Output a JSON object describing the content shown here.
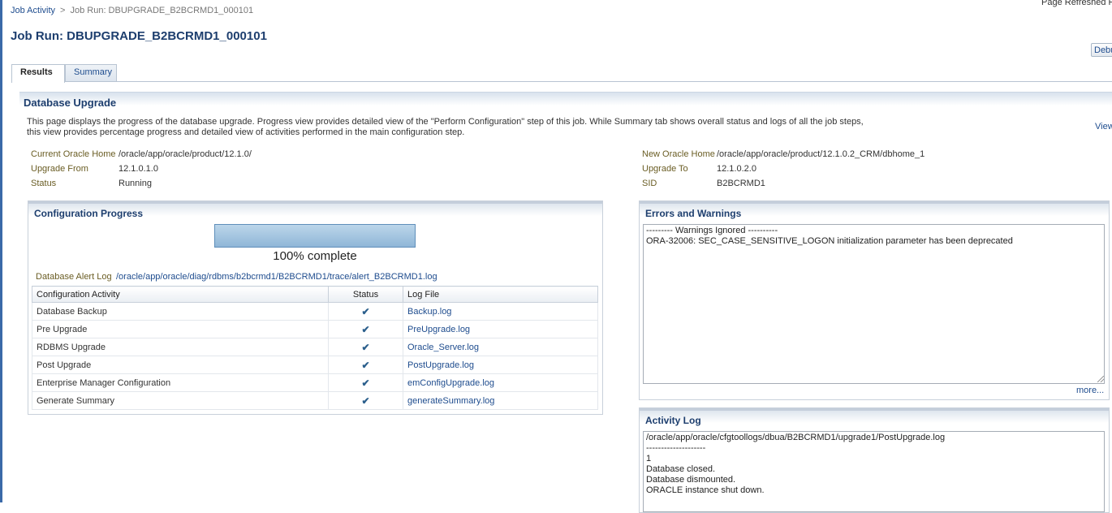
{
  "breadcrumb": {
    "parent": "Job Activity",
    "separator": ">",
    "current": "Job Run: DBUPGRADE_B2BCRMD1_000101"
  },
  "header": {
    "refreshed": "Page Refreshed F",
    "title": "Job Run: DBUPGRADE_B2BCRMD1_000101",
    "debug_label": "Debu"
  },
  "tabs": [
    {
      "label": "Results"
    },
    {
      "label": "Summary"
    }
  ],
  "section": {
    "title": "Database Upgrade",
    "description_line1": "This page displays the progress of the database upgrade. Progress view provides detailed view of the \"Perform Configuration\" step of this job. While Summary tab shows overall status and logs of all the job steps,",
    "description_line2": "this view provides percentage progress and detailed view of activities performed in the main configuration step.",
    "view_link": "View"
  },
  "info_left": [
    {
      "label": "Current Oracle Home",
      "value": "/oracle/app/oracle/product/12.1.0/"
    },
    {
      "label": "Upgrade From",
      "value": "12.1.0.1.0"
    },
    {
      "label": "Status",
      "value": "Running"
    }
  ],
  "info_right": [
    {
      "label": "New Oracle Home",
      "value": "/oracle/app/oracle/product/12.1.0.2_CRM/dbhome_1"
    },
    {
      "label": "Upgrade To",
      "value": "12.1.0.2.0"
    },
    {
      "label": "SID",
      "value": "B2BCRMD1"
    }
  ],
  "config_progress": {
    "title": "Configuration Progress",
    "progress_percent": 100,
    "progress_label": "100% complete",
    "alert_log_label": "Database Alert Log",
    "alert_log_path": "/oracle/app/oracle/diag/rdbms/b2bcrmd1/B2BCRMD1/trace/alert_B2BCRMD1.log",
    "columns": [
      "Configuration Activity",
      "Status",
      "Log File"
    ],
    "rows": [
      {
        "activity": "Database Backup",
        "status": "✔",
        "log": "Backup.log"
      },
      {
        "activity": "Pre Upgrade",
        "status": "✔",
        "log": "PreUpgrade.log"
      },
      {
        "activity": "RDBMS Upgrade",
        "status": "✔",
        "log": "Oracle_Server.log"
      },
      {
        "activity": "Post Upgrade",
        "status": "✔",
        "log": "PostUpgrade.log"
      },
      {
        "activity": "Enterprise Manager Configuration",
        "status": "✔",
        "log": "emConfigUpgrade.log"
      },
      {
        "activity": "Generate Summary",
        "status": "✔",
        "log": "generateSummary.log"
      }
    ]
  },
  "errors_warnings": {
    "title": "Errors and Warnings",
    "text": "--------- Warnings Ignored ----------\nORA-32006: SEC_CASE_SENSITIVE_LOGON initialization parameter has been deprecated",
    "more_link": "more..."
  },
  "activity_log": {
    "title": "Activity Log",
    "text": "/oracle/app/oracle/cfgtoollogs/dbua/B2BCRMD1/upgrade1/PostUpgrade.log\n--------------------\n1\nDatabase closed.\nDatabase dismounted.\nORACLE instance shut down."
  },
  "colors": {
    "accent": "#1d3e6e",
    "link": "#1e4c8e",
    "label": "#6a5d24"
  }
}
